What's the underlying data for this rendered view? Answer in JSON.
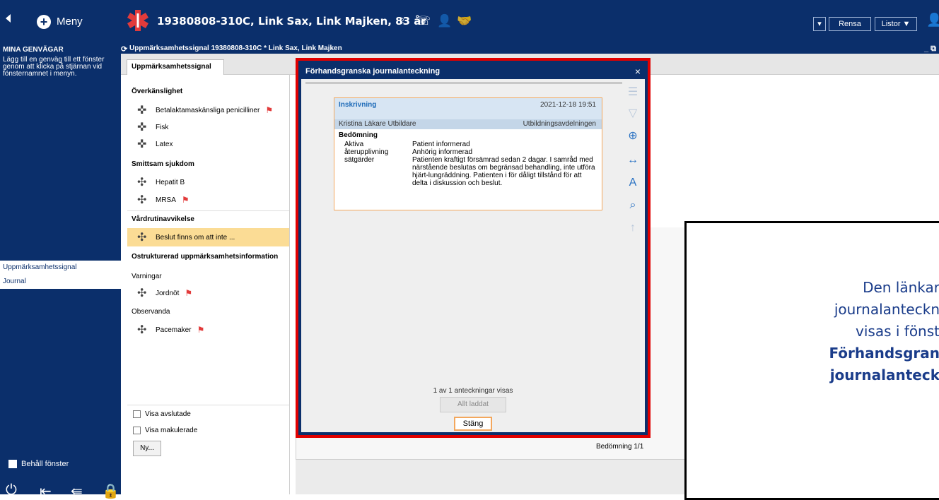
{
  "topbar": {
    "menu_label": "Meny",
    "patient": "19380808-310C, Link Sax, Link Majken, 83 år",
    "rensa_label": "Rensa",
    "listor_label": "Listor ▼",
    "colors": {
      "bg": "#0b2f6b",
      "accent": "#e00000"
    }
  },
  "left": {
    "heading": "MINA GENVÄGAR",
    "hint": "Lägg till en genväg till ett fönster genom att klicka på stjärnan vid fönsternamnet i menyn.",
    "nav": [
      "Uppmärksamhetssignal",
      "Journal"
    ],
    "keep_label": "Behåll fönster"
  },
  "window": {
    "title": "Uppmärksamhetssignal 19380808-310C * Link Sax, Link Majken",
    "tab": "Uppmärksamhetssignal"
  },
  "panel": {
    "sec_overkanslighet": "Överkänslighet",
    "item_penicilliner": "Betalaktamaskänsliga penicilliner",
    "item_fisk": "Fisk",
    "item_latex": "Latex",
    "sec_smitta": "Smittsam sjukdom",
    "item_hepatit": "Hepatit B",
    "item_mrsa": "MRSA",
    "sec_vard": "Vårdrutinavvikelse",
    "item_beslut": "Beslut finns om att inte ...",
    "sec_ostr": "Ostrukturerad uppmärksamhetsinformation",
    "sub_varningar": "Varningar",
    "item_jordnot": "Jordnöt",
    "sub_observanda": "Observanda",
    "item_pacemaker": "Pacemaker",
    "visa_avslutade": "Visa avslutade",
    "visa_makulerade": "Visa makulerade",
    "ny_label": "Ny..."
  },
  "status": {
    "bedomning": "Bedömning 1/1"
  },
  "dialog": {
    "title": "Förhandsgranska journalanteckning",
    "close": "×",
    "note": {
      "title": "Inskrivning",
      "date": "2021-12-18 19:51",
      "author": "Kristina Läkare Utbildare",
      "unit": "Utbildningsavdelningen",
      "section": "Bedömning",
      "kw1": "Aktiva",
      "kw2": "återupplivning",
      "kw3": "sätgärder",
      "v1": "Patient informerad",
      "v2": "Anhörig informerad",
      "v3": "Patienten kraftigt försämrad sedan 2 dagar. I samråd med närstående beslutas om begränsad behandling, inte utföra hjärt-lungräddning. Patienten i för dåligt tillstånd för att delta i diskussion och beslut."
    },
    "count": "1 av 1 anteckningar visas",
    "allt_laddat": "Allt laddat",
    "stang": "Stäng"
  },
  "callout": {
    "line1": "Den länkar",
    "line2": "journalanteckn",
    "line3": "visas i fönst",
    "line4": "Förhandsgran",
    "line5": "journalanteck"
  }
}
